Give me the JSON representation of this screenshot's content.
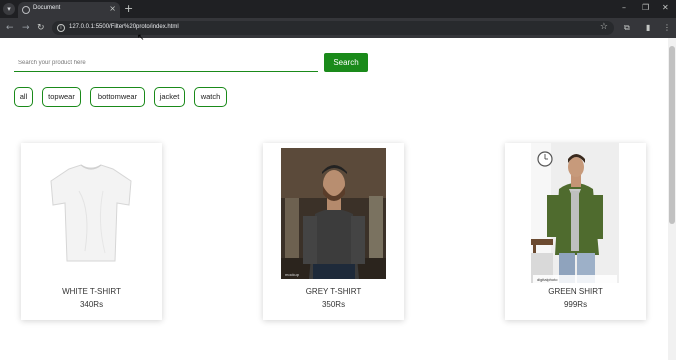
{
  "browser": {
    "tab_title": "Document",
    "url": "127.0.0.1:5500/Filter%20proto/index.html"
  },
  "search": {
    "placeholder": "Search your product here",
    "button_label": "Search"
  },
  "filters": [
    "all",
    "topwear",
    "bottomwear",
    "jacket",
    "watch"
  ],
  "products": [
    {
      "name": "WHITE T-SHIRT",
      "price": "340Rs"
    },
    {
      "name": "GREY T-SHIRT",
      "price": "350Rs"
    },
    {
      "name": "GREEN SHIRT",
      "price": "999Rs"
    }
  ],
  "colors": {
    "accent": "#1a8a1a",
    "chrome_dark": "#1f2023",
    "chrome_toolbar": "#35363a"
  }
}
